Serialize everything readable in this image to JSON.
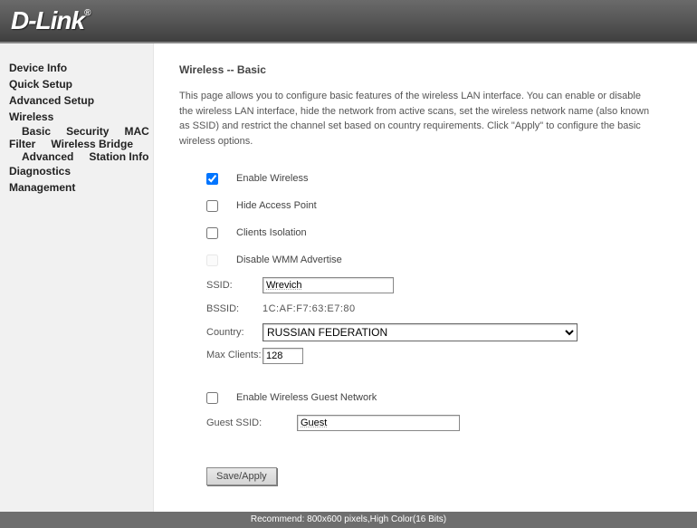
{
  "brand": "D-Link",
  "nav": {
    "device_info": "Device Info",
    "quick_setup": "Quick Setup",
    "advanced_setup": "Advanced Setup",
    "wireless": "Wireless",
    "wl_basic": "Basic",
    "wl_security": "Security",
    "wl_mac": "MAC Filter",
    "wl_bridge": "Wireless Bridge",
    "wl_advanced": "Advanced",
    "wl_station": "Station Info",
    "diagnostics": "Diagnostics",
    "management": "Management"
  },
  "page": {
    "title": "Wireless -- Basic",
    "desc": "This page allows you to configure basic features of the wireless LAN interface. You can enable or disable the wireless LAN interface, hide the network from active scans, set the wireless network name (also known as SSID) and restrict the channel set based on country requirements. Click \"Apply\" to configure the basic wireless options."
  },
  "form": {
    "enable_wireless": "Enable Wireless",
    "hide_ap": "Hide Access Point",
    "clients_iso": "Clients Isolation",
    "disable_wmm": "Disable WMM Advertise",
    "ssid_label": "SSID:",
    "ssid_value": "Wrevich",
    "bssid_label": "BSSID:",
    "bssid_value": "1C:AF:F7:63:E7:80",
    "country_label": "Country:",
    "country_value": "RUSSIAN FEDERATION",
    "max_clients_label": "Max Clients:",
    "max_clients_value": "128",
    "enable_guest": "Enable Wireless Guest Network",
    "guest_ssid_label": "Guest SSID:",
    "guest_ssid_value": "Guest",
    "save_apply": "Save/Apply"
  },
  "footer": "Recommend: 800x600 pixels,High Color(16 Bits)"
}
